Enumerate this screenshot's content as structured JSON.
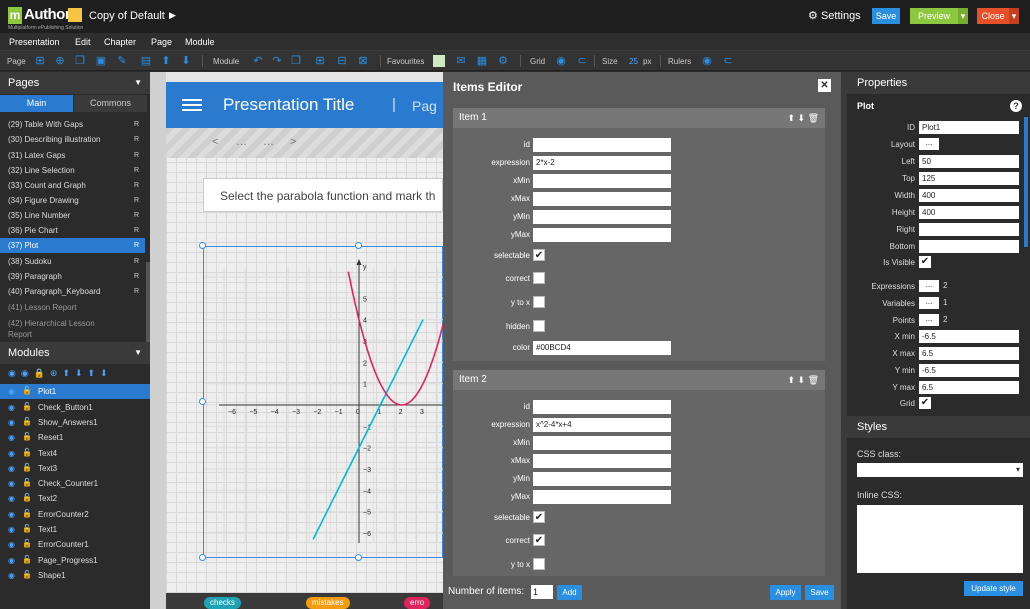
{
  "app": {
    "logo_mark": "m",
    "logo_text": "Author",
    "logo_subtitle": "Multiplatform ePublishing Solution",
    "presentation_title": "Copy of Default",
    "settings_label": "Settings",
    "save_label": "Save",
    "preview_label": "Preview",
    "close_label": "Close",
    "accent_color": "#2a8fe0",
    "preview_color": "#8dc63f",
    "close_color": "#e8502a"
  },
  "menu": [
    "Presentation",
    "Edit",
    "Chapter",
    "Page",
    "Module"
  ],
  "toolbar": {
    "page_label": "Page",
    "module_label": "Module",
    "favourites_label": "Favourites",
    "grid_label": "Grid",
    "size_label": "Size",
    "size_value": "25",
    "size_unit": "px",
    "rulers_label": "Rulers"
  },
  "pages_panel": {
    "title": "Pages",
    "tabs": [
      "Main",
      "Commons"
    ],
    "items": [
      {
        "label": "(29) Table With Gaps",
        "flag": "R"
      },
      {
        "label": "(30) Describing illustration",
        "flag": "R"
      },
      {
        "label": "(31) Latex Gaps",
        "flag": "R"
      },
      {
        "label": "(32) Line Selection",
        "flag": "R"
      },
      {
        "label": "(33) Count and Graph",
        "flag": "R"
      },
      {
        "label": "(34) Figure Drawing",
        "flag": "R"
      },
      {
        "label": "(35) Line Number",
        "flag": "R"
      },
      {
        "label": "(36) Pie Chart",
        "flag": "R"
      },
      {
        "label": "(37) Plot",
        "flag": "R"
      },
      {
        "label": "(38) Sudoku",
        "flag": "R"
      },
      {
        "label": "(39) Paragraph",
        "flag": "R"
      },
      {
        "label": "(40) Paragraph_Keyboard",
        "flag": "R"
      },
      {
        "label": "(41) Lesson Report",
        "flag": ""
      },
      {
        "label": "(42) Hierarchical Lesson",
        "flag": ""
      },
      {
        "label": "Report",
        "flag": ""
      }
    ]
  },
  "modules_panel": {
    "title": "Modules",
    "items": [
      "Plot1",
      "Check_Button1",
      "Show_Answers1",
      "Reset1",
      "Text4",
      "Text3",
      "Check_Counter1",
      "Text2",
      "ErrorCounter2",
      "Text1",
      "ErrorCounter1",
      "Page_Progress1",
      "Shape1"
    ]
  },
  "canvas": {
    "header_title": "Presentation Title",
    "header_sep": "|",
    "header_page": "Pag",
    "nav_prev": "<",
    "nav_dots1": "…",
    "nav_dots2": "…",
    "nav_next": ">",
    "question": "Select the parabola function and mark th",
    "chip1": "checks",
    "chip2": "mistakes",
    "chip3": "erro"
  },
  "plot": {
    "y_axis_label": "y",
    "x_ticks": [
      "−6",
      "−5",
      "−4",
      "−3",
      "−2",
      "−1",
      "0",
      "1",
      "2",
      "3"
    ],
    "y_ticks": [
      "5",
      "4",
      "3",
      "2",
      "1",
      "−1",
      "−2",
      "−3",
      "−4",
      "−5",
      "−6"
    ],
    "line_color": "#00BCD4",
    "parabola_color": "#e0245e"
  },
  "items_editor": {
    "title": "Items Editor",
    "items": [
      {
        "header": "Item 1",
        "id": "",
        "expression": "2*x-2",
        "xMin": "",
        "xMax": "",
        "yMin": "",
        "yMax": "",
        "selectable": true,
        "correct": false,
        "y_to_x": false,
        "hidden": false,
        "color": "#00BCD4"
      },
      {
        "header": "Item 2",
        "id": "",
        "expression": "x^2-4*x+4",
        "xMin": "",
        "xMax": "",
        "yMin": "",
        "yMax": "",
        "selectable": true,
        "correct": true,
        "y_to_x": false
      }
    ],
    "labels": {
      "id": "id",
      "expression": "expression",
      "xMin": "xMin",
      "xMax": "xMax",
      "yMin": "yMin",
      "yMax": "yMax",
      "selectable": "selectable",
      "correct": "correct",
      "y_to_x": "y to x",
      "hidden": "hidden",
      "color": "color"
    },
    "number_of_items_label": "Number of items:",
    "number_of_items_value": "1",
    "add_label": "Add",
    "apply_label": "Apply",
    "save_label": "Save"
  },
  "properties": {
    "title": "Properties",
    "section": "Plot",
    "help": "?",
    "fields": {
      "ID": "Plot1",
      "Layout": "...",
      "Left": "50",
      "Top": "125",
      "Width": "400",
      "Height": "400",
      "Right": "",
      "Bottom": "",
      "Is Visible": true
    },
    "expressions_count": "2",
    "variables_count": "1",
    "points_count": "2",
    "x_min": "-6.5",
    "x_max": "6.5",
    "y_min": "-6.5",
    "y_max": "6.5",
    "grid": true,
    "labels": {
      "id": "ID",
      "layout": "Layout",
      "left": "Left",
      "top": "Top",
      "width": "Width",
      "height": "Height",
      "right": "Right",
      "bottom": "Bottom",
      "is_visible": "Is Visible",
      "expressions": "Expressions",
      "variables": "Variables",
      "points": "Points",
      "x_min": "X min",
      "x_max": "X max",
      "y_min": "Y min",
      "y_max": "Y max",
      "grid": "Grid"
    },
    "ellipsis": "..."
  },
  "styles": {
    "title": "Styles",
    "css_class_label": "CSS class:",
    "inline_css_label": "Inline CSS:",
    "update_label": "Update style"
  }
}
